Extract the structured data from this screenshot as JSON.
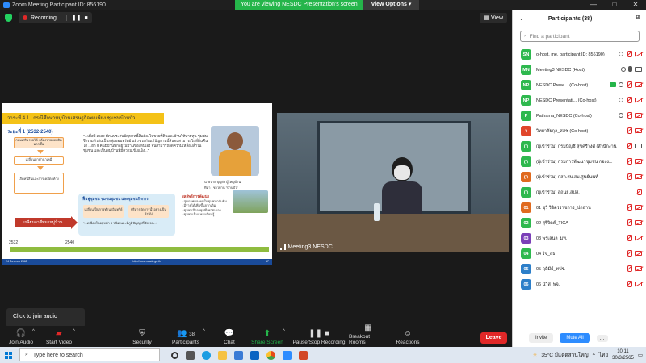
{
  "window": {
    "title": "Zoom Meeting Participant ID: 856190",
    "controls": [
      "—",
      "□",
      "✕"
    ]
  },
  "share_banner": {
    "viewing_text": "You are viewing NESDC Presentation's screen",
    "view_options_label": "View Options ▾"
  },
  "topbar": {
    "recording_label": "Recording...",
    "view_label": "View"
  },
  "slide": {
    "header": "วาระที่ 4.1 : กรณีศึกษาหมู่บ้านเศรษฐกิจพอเพียง ชุมชนบ้านบัว",
    "era": "ระยะที่ 1 (2532-2540)",
    "quote": "\"...เมื่อปี 2532 มีคนประสบปัญหาหนี้สินต้องไปขายที่ดินและบ้านให้นายทุน ชุมชนจึงรวมตัวกันเป็นกลุ่มออมทรัพย์ แล้วช่วยกันแก้ปัญหาหนี้สินจนสามารถไถ่ที่ดินคืนได้ ...อีก 9 คนมีบ้านพักอยู่ในบ้านของตนเอง จนสามารถลดความเหลื่อมล้ำในชุมชน และเป็นหมู่บ้านที่มีความเข้มแข็ง...\"",
    "caption_name": "นายนาย บุญกัง ผู้ใหญ่บ้าน",
    "caption_role": "ที่มา : ชาวบ้าน \"บ้านบัว\"",
    "box1": "กอมเสริมรายได้ / ต้องขายผลผลิตมากขึ้น",
    "box2": "เปลี่ยนมาทำนาเคมี",
    "box3": "เกิดหนี้สินและสารเคมีตกค้าง",
    "red_label": "เกษียนอาชีพมาหมู่บ้าน",
    "sub_title": "ฟื้นฟูชุมชน ชุมชนชุมชน และชุมชนกิจการ",
    "sub_box1": "เปลี่ยนเป็นการทำนาอินทรีย์",
    "sub_box2": "บริหารจัดการน้ำอย่างเป็นระบบ",
    "sub_quote": "\"...เพนียงในอยู่หลัก 3 ชนิด และมีภูมิปัญญาที่ชัดเจน...\"",
    "right_title": "ผลลัพธ์การพัฒนา",
    "right_items": [
      "• สุขภาพของคนในชุมชนกลับคืน",
      "• มีรายได้เพิ่มขึ้นจากเดิม",
      "• ชุมชนมีกองทุนพึ่งพาตนเอง",
      "• ชุมชนเป็นแหล่งเรียนรู้"
    ],
    "timeline_start": "2532",
    "timeline_end": "2540",
    "footer_left": "24 ธันวาคม 2565",
    "footer_mid": "http://www.nesdc.go.th",
    "footer_right": "17"
  },
  "video": {
    "participant_name": "Meeting3 NESDC"
  },
  "tooltip": {
    "text": "Click to join audio"
  },
  "toolbar": {
    "join_audio": "Join Audio",
    "start_video": "Start Video",
    "security": "Security",
    "participants": "Participants",
    "participants_count": "38",
    "chat": "Chat",
    "share_screen": "Share Screen",
    "pause_stop_recording": "Pause/Stop Recording",
    "breakout_rooms": "Breakout Rooms",
    "reactions": "Reactions",
    "leave": "Leave"
  },
  "participants_panel": {
    "title": "Participants (38)",
    "search_placeholder": "Find a participant",
    "invite_label": "Invite",
    "mute_all_label": "Mute All",
    "more_label": "...",
    "items": [
      {
        "initials": "SN",
        "color": "#2eb84e",
        "name": "o-host, me, participant ID: 856190)"
      },
      {
        "initials": "MN",
        "color": "#2eb84e",
        "name": "Meeting3 NESDC (Host)"
      },
      {
        "initials": "NP",
        "color": "#2eb84e",
        "name": "NESDC Prese... (Co-host)"
      },
      {
        "initials": "NP",
        "color": "#2eb84e",
        "name": "NESDC Presentati... (Co-host)"
      },
      {
        "initials": "P",
        "color": "#2eb84e",
        "name": "Pathama_NESDC (Co-host)"
      },
      {
        "initials": "ว",
        "color": "#e0462b",
        "name": "วิทยาลัยกุล_สสช (Co-host)"
      },
      {
        "initials": "(ก",
        "color": "#2eb84e",
        "name": "(ผู้เข้าร่วม) กรมบัญชี สุขศรีวงศ์ (สำนักงาน..."
      },
      {
        "initials": "(ก",
        "color": "#2eb84e",
        "name": "(ผู้เข้าร่วม) กรมการพัฒนาชุมชน กองง..."
      },
      {
        "initials": "(ก",
        "color": "#e06a1f",
        "name": "(ผู้เข้าร่วม) กสก.สบ.สบ.ศูนย์นนท์"
      },
      {
        "initials": "(ก",
        "color": "#2eb84e",
        "name": "(ผู้เข้าร่วม) สถนย.สปส."
      },
      {
        "initials": "01",
        "color": "#e06a1f",
        "name": "01 ชุรี ริจิตรราชการ_ปกอาน"
      },
      {
        "initials": "02",
        "color": "#2eb84e",
        "name": "02 สุริจิตต์_TICA"
      },
      {
        "initials": "03",
        "color": "#7b3fb8",
        "name": "03 พรเลนล_มท."
      },
      {
        "initials": "04",
        "color": "#2eb84e",
        "name": "04 ริจ_สธ."
      },
      {
        "initials": "05",
        "color": "#2d7fc9",
        "name": "05 ฤดีมีย์_ทปร."
      },
      {
        "initials": "06",
        "color": "#2d7fc9",
        "name": "06 นิวิส_พจ."
      }
    ]
  },
  "taskbar": {
    "search_placeholder": "Type here to search",
    "weather": "35°C มีแดดส่วนใหญ่",
    "lang": "ไทย",
    "time": "10:11",
    "date": "30/3/2565"
  }
}
